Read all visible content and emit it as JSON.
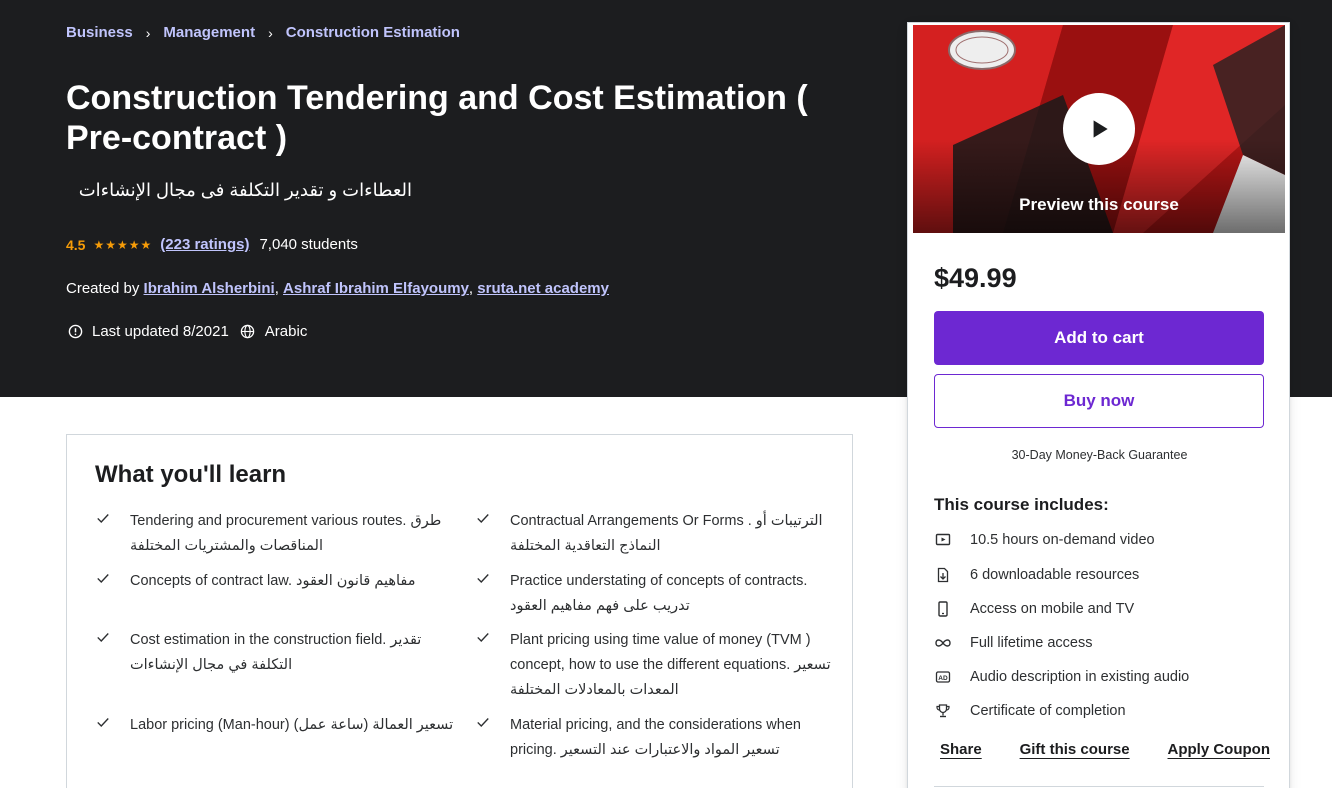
{
  "breadcrumb": [
    "Business",
    "Management",
    "Construction Estimation"
  ],
  "breadcrumb_separator": "›",
  "course": {
    "title": "Construction Tendering and Cost Estimation ( Pre-contract )",
    "subtitle": "العطاءات و تقدير التكلفة فى مجال الإنشاءات",
    "rating": "4.5",
    "stars": "★★★★★",
    "ratings_count": "(223 ratings)",
    "students": "7,040 students",
    "created_by_label": "Created by",
    "instructors": [
      "Ibrahim Alsherbini",
      "Ashraf Ibrahim Elfayoumy",
      "sruta.net academy"
    ],
    "last_updated": "Last updated 8/2021",
    "language": "Arabic"
  },
  "learn": {
    "title": "What you'll learn",
    "items": [
      "Tendering and procurement various routes. طرق المناقصات والمشتريات المختلفة",
      "Contractual Arrangements Or Forms . الترتيبات أو النماذج التعاقدية المختلفة",
      "Concepts of contract law. مفاهيم قانون العقود",
      "Practice understating of concepts of contracts. تدريب على فهم مفاهيم العقود",
      "Cost estimation in the construction field. تقدير التكلفة في مجال الإنشاءات",
      "Plant pricing using time value of money (TVM ) concept, how to use the different equations. تسعير المعدات بالمعادلات المختلفة",
      "Labor pricing (Man-hour) تسعير العمالة (ساعة عمل)",
      "Material pricing, and the considerations when pricing. تسعير المواد والاعتبارات عند التسعير"
    ]
  },
  "sidebar": {
    "preview_label": "Preview this course",
    "price": "$49.99",
    "add_to_cart": "Add to cart",
    "buy_now": "Buy now",
    "guarantee": "30-Day Money-Back Guarantee",
    "includes_title": "This course includes:",
    "includes": [
      {
        "icon": "video-icon",
        "text": "10.5 hours on-demand video"
      },
      {
        "icon": "file-download-icon",
        "text": "6 downloadable resources"
      },
      {
        "icon": "mobile-icon",
        "text": "Access on mobile and TV"
      },
      {
        "icon": "infinity-icon",
        "text": "Full lifetime access"
      },
      {
        "icon": "audio-description-icon",
        "text": "Audio description in existing audio"
      },
      {
        "icon": "trophy-icon",
        "text": "Certificate of completion"
      }
    ],
    "share": "Share",
    "gift": "Gift this course",
    "coupon": "Apply Coupon"
  },
  "colors": {
    "hero_bg": "#1c1d1f",
    "link": "#c0c4fc",
    "star": "#f69c08",
    "primary": "#6d28d2"
  }
}
